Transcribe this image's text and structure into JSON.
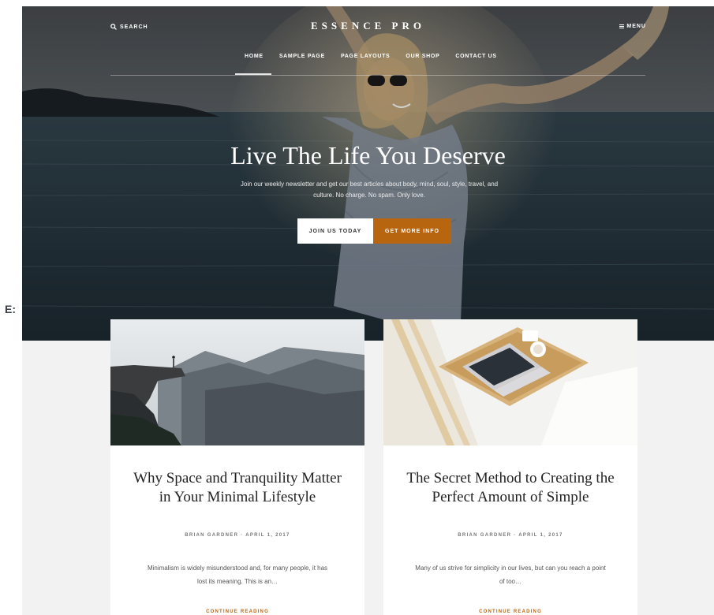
{
  "edge_label": "E:",
  "header": {
    "search_label": "SEARCH",
    "site_title": "ESSENCE PRO",
    "menu_label": "MENU"
  },
  "nav": {
    "items": [
      "HOME",
      "SAMPLE PAGE",
      "PAGE LAYOUTS",
      "OUR SHOP",
      "CONTACT US"
    ],
    "active": "HOME"
  },
  "hero": {
    "title": "Live The Life You Deserve",
    "subtitle": "Join our weekly newsletter and get our best articles about body, mind, soul, style, travel, and culture. No charge. No spam. Only love.",
    "button_primary": "JOIN US TODAY",
    "button_secondary": "GET MORE INFO"
  },
  "posts": [
    {
      "title": "Why Space and Tranquility Matter in Your Minimal Lifestyle",
      "meta": "BRIAN GARDNER · APRIL 1, 2017",
      "excerpt": "Minimalism is widely misunderstood and, for many people, it has lost its meaning. This is an…",
      "read_more": "CONTINUE READING",
      "image_icon": "mountain-cliff-photo"
    },
    {
      "title": "The Secret Method to Creating the Perfect Amount of Simple",
      "meta": "BRIAN GARDNER · APRIL 1, 2017",
      "excerpt": "Many of us strive for simplicity in our lives, but can you reach a point of too…",
      "read_more": "CONTINUE READING",
      "image_icon": "laptop-tray-photo"
    }
  ],
  "colors": {
    "accent": "#b8650f",
    "page_bg": "#f2f2f2",
    "card_bg": "#ffffff"
  }
}
